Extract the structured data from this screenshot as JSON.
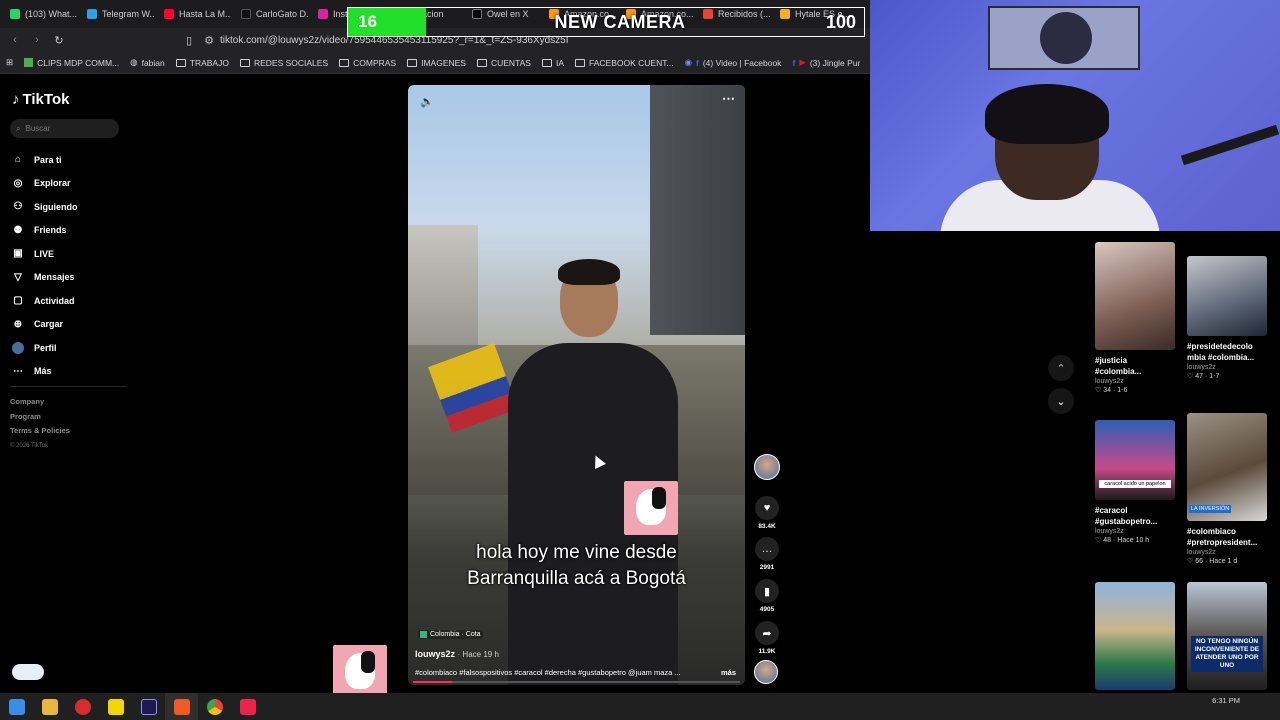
{
  "browser": {
    "tabs": [
      "(103) What...",
      "Telegram W...",
      "Hasta La M...",
      "CarloGato D...",
      "Insta...",
      "...cacion",
      "Owel en X",
      "Amazon.co...",
      "Amazon.co...",
      "Recibidos (...",
      "Hytale ES e..."
    ],
    "url": "tiktok.com/@louwys2z/video/7595446535453115925?_r=1&_t=ZS-936Xydsz5I",
    "bookmarks": [
      "CLIPS MDP COMM...",
      "fabian",
      "TRABAJO",
      "REDES SOCIALES",
      "COMPRAS",
      "IMAGENES",
      "CUENTAS",
      "IA",
      "FACEBOOK CUENT...",
      "(4) Video | Facebook",
      "(3) Jingle Pur"
    ]
  },
  "overlay": {
    "count": "16",
    "title": "NEW CAMERA",
    "max": "100",
    "progress": 0.16
  },
  "tiktok": {
    "logo": "TikTok",
    "search_placeholder": "Buscar",
    "menu": [
      {
        "label": "Para ti",
        "icon": "home-icon"
      },
      {
        "label": "Explorar",
        "icon": "compass-icon"
      },
      {
        "label": "Siguiendo",
        "icon": "following-icon"
      },
      {
        "label": "Friends",
        "icon": "friends-icon"
      },
      {
        "label": "LIVE",
        "icon": "live-icon"
      },
      {
        "label": "Mensajes",
        "icon": "messages-icon"
      },
      {
        "label": "Actividad",
        "icon": "activity-icon"
      },
      {
        "label": "Cargar",
        "icon": "upload-icon"
      },
      {
        "label": "Perfil",
        "icon": "profile-avatar"
      },
      {
        "label": "Más",
        "icon": "more-icon"
      }
    ],
    "footer": [
      "Company",
      "Program",
      "Terms & Policies"
    ],
    "copyright": "© 2026 TikTok"
  },
  "video": {
    "caption_line1": "hola hoy me vine desde",
    "caption_line2": "Barranquilla acá a Bogotá",
    "location": "Colombia · Cota",
    "author": "louwys2z",
    "time": "· Hace 19 h",
    "tags": "#colombiaco #falsospositivos #caracol #derecha #gustabopetro @juam maza ...",
    "more": "más",
    "progress": 0.12,
    "likes": "83.4K",
    "comments": "2991",
    "saves": "4905",
    "shares": "11.9K"
  },
  "recommended": [
    {
      "title": "#justicia #colombia...",
      "author": "louwys2z",
      "views": "34",
      "time": "1-6"
    },
    {
      "title": "#presidetedecolo mbia #colombia...",
      "author": "louwys2z",
      "views": "47",
      "time": "1-7"
    },
    {
      "title": "#caracol #gustabopetro...",
      "author": "louwys2z",
      "views": "48",
      "time": "Hace 10 h",
      "sticker": "caracol acido un papelon"
    },
    {
      "title": "#colombiaco #pretropresident...",
      "author": "louwys2z",
      "views": "66",
      "time": "Hace 1 d",
      "badge": "LA INVERSIÓN"
    },
    {
      "title": "",
      "author": "",
      "views": "",
      "time": ""
    },
    {
      "title": "",
      "author": "",
      "views": "",
      "time": "",
      "overtext": "NO TENGO NINGÚN INCONVENIENTE DE ATENDER UNO POR UNO"
    }
  ],
  "taskbar": {
    "clock": "6:31 PM"
  },
  "colors": {
    "accent": "#fe2c55",
    "overlay_green": "#22e02a"
  }
}
